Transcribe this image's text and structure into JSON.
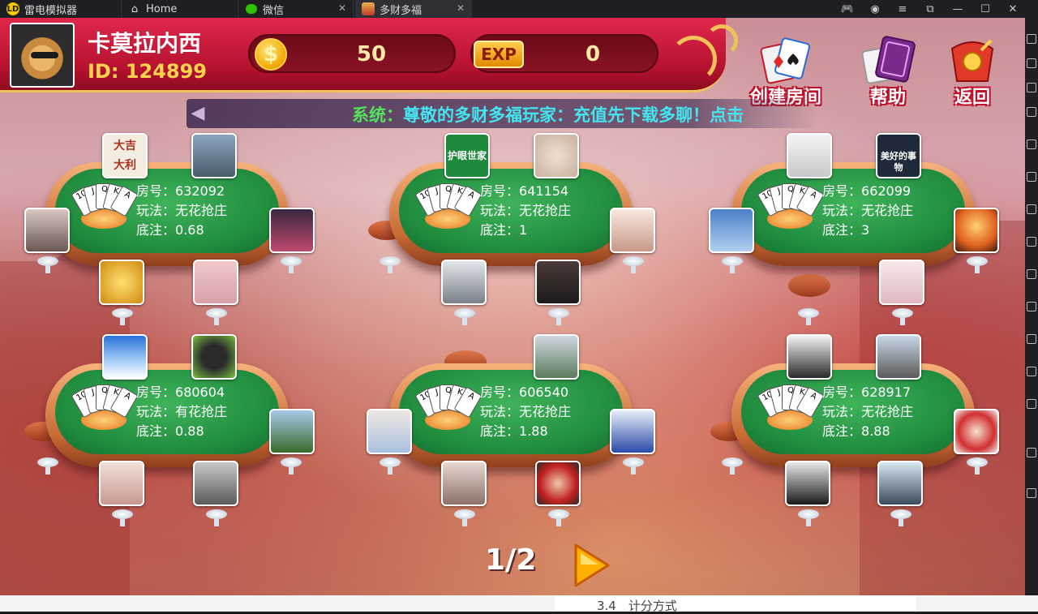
{
  "window": {
    "tabs": [
      {
        "label": "雷电模拟器",
        "icon": "ldplayer-logo-icon"
      },
      {
        "label": "Home",
        "icon": "home-icon"
      },
      {
        "label": "微信",
        "icon": "wechat-icon"
      },
      {
        "label": "多财多福",
        "icon": "game-icon",
        "active": true
      }
    ],
    "controls": [
      "gamepad-icon",
      "account-icon",
      "menu-icon",
      "minimize-icon",
      "restore-icon",
      "maximize-icon",
      "close-icon"
    ]
  },
  "player": {
    "name": "卡莫拉内西",
    "id_text": "ID: 124899",
    "coins": "50",
    "exp_label": "EXP",
    "exp": "0",
    "coin_symbol": "$"
  },
  "actions": {
    "create_room": "创建房间",
    "help": "帮助",
    "back": "返回"
  },
  "marquee": {
    "system_label": "系统：",
    "message": "尊敬的多财多福玩家：充值先下载多聊！点击"
  },
  "labels": {
    "room_no": "房号：",
    "play_mode": "玩法：",
    "base_bet": "底注："
  },
  "tables": [
    {
      "room": "632092",
      "mode": "无花抢庄",
      "bet": "0.68"
    },
    {
      "room": "641154",
      "mode": "无花抢庄",
      "bet": "1"
    },
    {
      "room": "662099",
      "mode": "无花抢庄",
      "bet": "3"
    },
    {
      "room": "680604",
      "mode": "有花抢庄",
      "bet": "0.88"
    },
    {
      "room": "606540",
      "mode": "无花抢庄",
      "bet": "1.88"
    },
    {
      "room": "628917",
      "mode": "无花抢庄",
      "bet": "8.88"
    }
  ],
  "avatar_texts": {
    "dajidali": "大吉大利",
    "huyan": "护眼世家",
    "meihao": "美好的事物"
  },
  "card_ranks": [
    "10",
    "J",
    "Q",
    "K",
    "A"
  ],
  "pagination": {
    "current": "1/2"
  },
  "bottom_text": "3.4　计分方式",
  "colors": {
    "header_red": "#c8163a",
    "felt_green": "#1f8a3d",
    "gold": "#f0c25a",
    "marquee_green": "#54e35a",
    "marquee_cyan": "#43e6f0"
  }
}
